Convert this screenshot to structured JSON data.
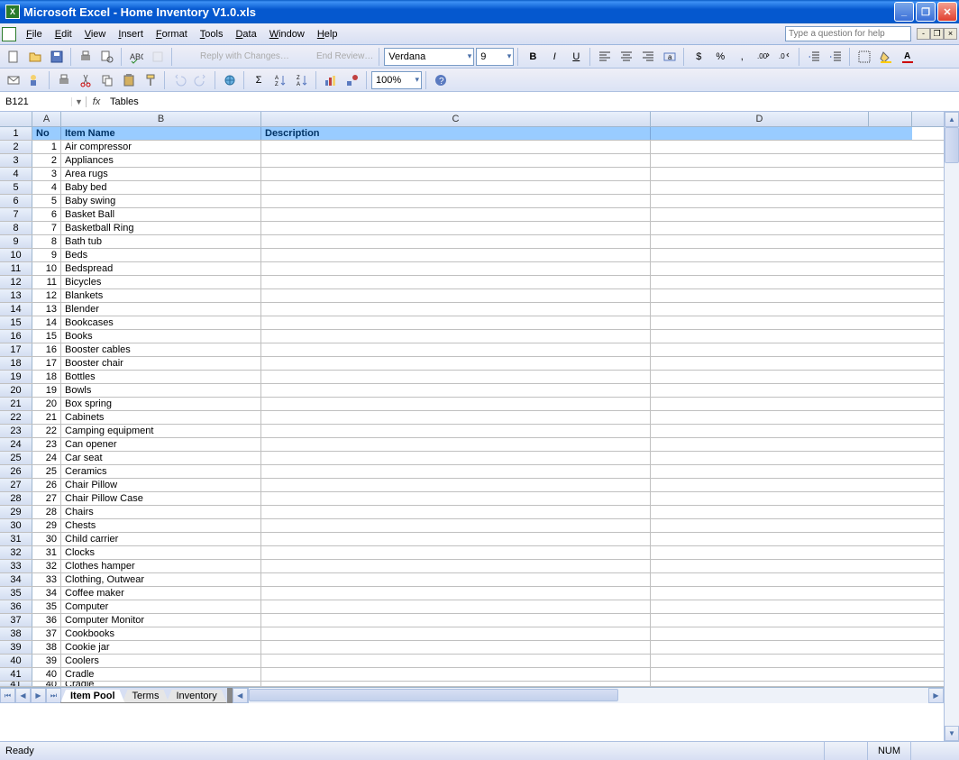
{
  "title": "Microsoft Excel - Home Inventory V1.0.xls",
  "menu": [
    "File",
    "Edit",
    "View",
    "Insert",
    "Format",
    "Tools",
    "Data",
    "Window",
    "Help"
  ],
  "help_placeholder": "Type a question for help",
  "font_name": "Verdana",
  "font_size": "9",
  "zoom": "100%",
  "namebox": "B121",
  "formula": "Tables",
  "col_headers": {
    "A": "A",
    "B": "B",
    "C": "C",
    "D": "D",
    "E": ""
  },
  "headers": {
    "no": "No",
    "item": "Item Name",
    "desc": "Description"
  },
  "items": [
    "Air compressor",
    "Appliances",
    "Area rugs",
    "Baby bed",
    "Baby swing",
    "Basket Ball",
    "Basketball Ring",
    "Bath tub",
    "Beds",
    "Bedspread",
    "Bicycles",
    "Blankets",
    "Blender",
    "Bookcases",
    "Books",
    "Booster cables",
    "Booster chair",
    "Bottles",
    "Bowls",
    "Box spring",
    "Cabinets",
    "Camping equipment",
    "Can opener",
    "Car seat",
    "Ceramics",
    "Chair Pillow",
    "Chair Pillow Case",
    "Chairs",
    "Chests",
    "Child carrier",
    "Clocks",
    "Clothes hamper",
    "Clothing, Outwear",
    "Coffee maker",
    "Computer",
    "Computer Monitor",
    "Cookbooks",
    "Cookie jar",
    "Coolers",
    "Cradle"
  ],
  "sheet_tabs": [
    "Item Pool",
    "Terms",
    "Inventory"
  ],
  "active_tab": 0,
  "status": "Ready",
  "num_indicator": "NUM"
}
